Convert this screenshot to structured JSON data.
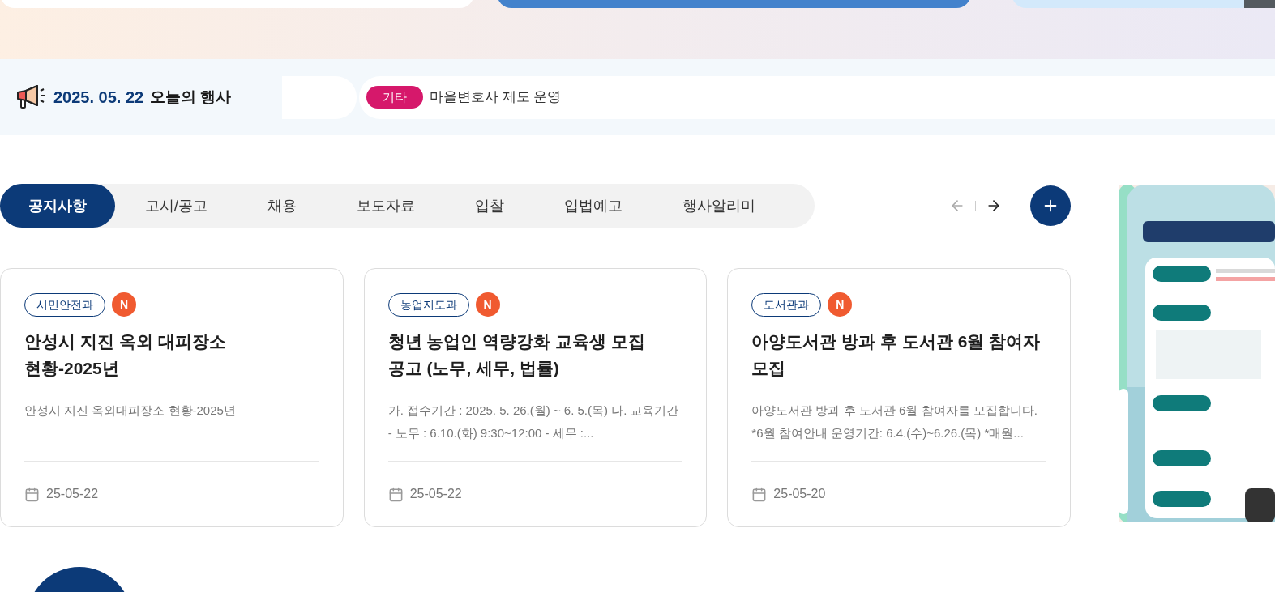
{
  "today": {
    "date": "2025. 05. 22",
    "label": "오늘의 행사"
  },
  "ticker": {
    "category": "기타",
    "text": "마을변호사 제도 운영"
  },
  "tabs": [
    {
      "label": "공지사항",
      "selected": true
    },
    {
      "label": "고시/공고",
      "selected": false
    },
    {
      "label": "채용",
      "selected": false
    },
    {
      "label": "보도자료",
      "selected": false
    },
    {
      "label": "입찰",
      "selected": false
    },
    {
      "label": "입법예고",
      "selected": false
    },
    {
      "label": "행사알리미",
      "selected": false
    }
  ],
  "nav": {
    "prev_disabled": true
  },
  "cards": [
    {
      "department": "시민안전과",
      "new_badge": "N",
      "title": "안성시 지진 옥외 대피장소 현황-2025년",
      "summary": "안성시 지진 옥외대피장소 현황-2025년",
      "date": "25-05-22"
    },
    {
      "department": "농업지도과",
      "new_badge": "N",
      "title": "청년 농업인 역량강화 교육생 모집 공고 (노무, 세무, 법률)",
      "summary": "가. 접수기간 : 2025. 5. 26.(월) ~ 6. 5.(목) 나. 교육기간 - 노무 : 6.10.(화) 9:30~12:00 - 세무 :...",
      "date": "25-05-22"
    },
    {
      "department": "도서관과",
      "new_badge": "N",
      "title": "아양도서관 방과 후 도서관 6월 참여자 모집",
      "summary": "아양도서관 방과 후 도서관 6월 참여자를 모집합니다. *6월 참여안내 운영기간: 6.4.(수)~6.26.(목) *매월...",
      "date": "25-05-20"
    }
  ]
}
